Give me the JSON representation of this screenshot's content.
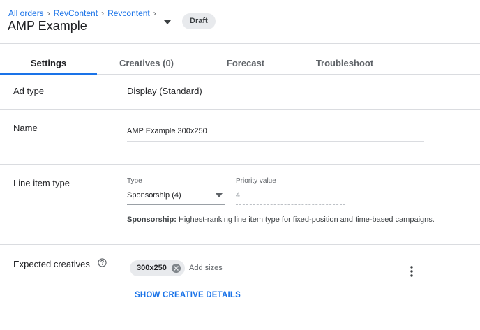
{
  "breadcrumb": {
    "items": [
      "All orders",
      "RevContent",
      "Revcontent"
    ],
    "separator": "›"
  },
  "header": {
    "title": "AMP Example",
    "status_badge": "Draft"
  },
  "tabs": [
    {
      "label": "Settings",
      "active": true
    },
    {
      "label": "Creatives (0)",
      "active": false
    },
    {
      "label": "Forecast",
      "active": false
    },
    {
      "label": "Troubleshoot",
      "active": false
    }
  ],
  "ad_type": {
    "label": "Ad type",
    "value": "Display (Standard)"
  },
  "name": {
    "label": "Name",
    "value": "AMP Example 300x250"
  },
  "line_item_type": {
    "label": "Line item type",
    "type_caption": "Type",
    "type_value": "Sponsorship (4)",
    "priority_caption": "Priority value",
    "priority_value": "4",
    "help_bold": "Sponsorship:",
    "help_text": " Highest-ranking line item type for fixed-position and time-based campaigns."
  },
  "expected_creatives": {
    "label": "Expected creatives",
    "chip": "300x250",
    "placeholder": "Add sizes",
    "link": "SHOW CREATIVE DETAILS"
  },
  "colors": {
    "accent": "#1a73e8",
    "divider": "#dadce0",
    "chip_bg": "#e8eaed"
  },
  "icons": {
    "title_caret": "caret-down-icon",
    "select_caret": "caret-down-icon",
    "help": "help-circle-icon",
    "chip_close": "cancel-circle-icon",
    "more": "more-vert-icon"
  }
}
